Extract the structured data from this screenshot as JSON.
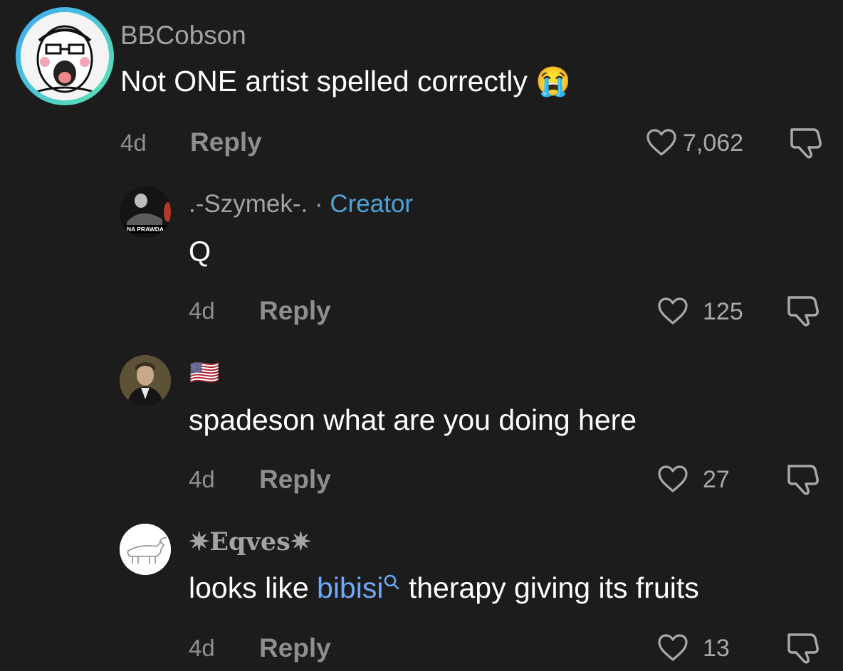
{
  "comments": [
    {
      "username": "BBCobson",
      "text": "Not ONE artist spelled correctly",
      "emoji": "😭",
      "time": "4d",
      "reply_label": "Reply",
      "likes": "7,062"
    },
    {
      "username": ".-Szymek-.",
      "separator": "·",
      "badge": "Creator",
      "avatar_caption": "NA PRAWDA",
      "text": "Q",
      "time": "4d",
      "reply_label": "Reply",
      "likes": "125"
    },
    {
      "username_flag": "🇺🇸",
      "text": "spadeson what are you doing here",
      "time": "4d",
      "reply_label": "Reply",
      "likes": "27"
    },
    {
      "username": "✷Eqves✷",
      "text_before": "looks like ",
      "link": "bibisi",
      "text_after": " therapy giving its fruits",
      "time": "4d",
      "reply_label": "Reply",
      "likes": "13"
    }
  ],
  "colors": {
    "background": "#1c1c1c",
    "creator_badge": "#4da3d6",
    "link": "#6fa8f5",
    "avatar_ring_start": "#3fa9f5",
    "avatar_ring_end": "#5be3b0"
  },
  "icons": [
    "heart-icon",
    "dislike-icon",
    "search-icon"
  ]
}
